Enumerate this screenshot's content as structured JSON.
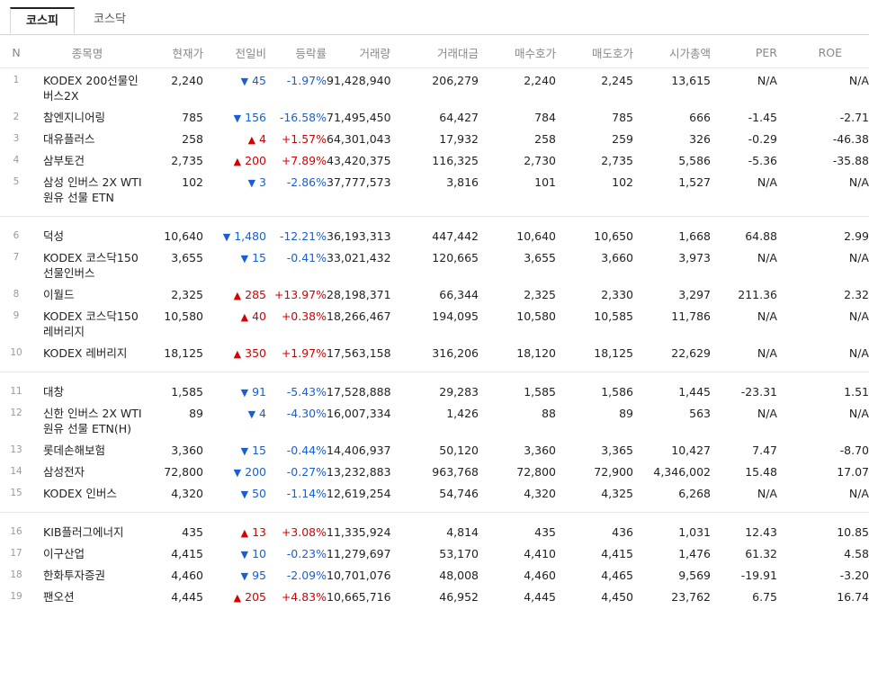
{
  "tabs": [
    {
      "label": "코스피",
      "active": true
    },
    {
      "label": "코스닥",
      "active": false
    }
  ],
  "columns": [
    "N",
    "종목명",
    "현재가",
    "전일비",
    "등락률",
    "거래량",
    "거래대금",
    "매수호가",
    "매도호가",
    "시가총액",
    "PER",
    "ROE"
  ],
  "colors": {
    "up": "#d60000",
    "down": "#1a5fd0"
  },
  "rows": [
    {
      "n": "1",
      "name": "KODEX 200선물인버스2X",
      "price": "2,240",
      "dir": "down",
      "change": "45",
      "rate": "-1.97%",
      "volume": "91,428,940",
      "amount": "206,279",
      "bid": "2,240",
      "ask": "2,245",
      "cap": "13,615",
      "per": "N/A",
      "roe": "N/A"
    },
    {
      "n": "2",
      "name": "참엔지니어링",
      "price": "785",
      "dir": "down",
      "change": "156",
      "rate": "-16.58%",
      "volume": "71,495,450",
      "amount": "64,427",
      "bid": "784",
      "ask": "785",
      "cap": "666",
      "per": "-1.45",
      "roe": "-2.71"
    },
    {
      "n": "3",
      "name": "대유플러스",
      "price": "258",
      "dir": "up",
      "change": "4",
      "rate": "+1.57%",
      "volume": "64,301,043",
      "amount": "17,932",
      "bid": "258",
      "ask": "259",
      "cap": "326",
      "per": "-0.29",
      "roe": "-46.38"
    },
    {
      "n": "4",
      "name": "삼부토건",
      "price": "2,735",
      "dir": "up",
      "change": "200",
      "rate": "+7.89%",
      "volume": "43,420,375",
      "amount": "116,325",
      "bid": "2,730",
      "ask": "2,735",
      "cap": "5,586",
      "per": "-5.36",
      "roe": "-35.88"
    },
    {
      "n": "5",
      "name": "삼성 인버스 2X WTI원유 선물 ETN",
      "price": "102",
      "dir": "down",
      "change": "3",
      "rate": "-2.86%",
      "volume": "37,777,573",
      "amount": "3,816",
      "bid": "101",
      "ask": "102",
      "cap": "1,527",
      "per": "N/A",
      "roe": "N/A"
    },
    {
      "n": "6",
      "name": "덕성",
      "price": "10,640",
      "dir": "down",
      "change": "1,480",
      "rate": "-12.21%",
      "volume": "36,193,313",
      "amount": "447,442",
      "bid": "10,640",
      "ask": "10,650",
      "cap": "1,668",
      "per": "64.88",
      "roe": "2.99"
    },
    {
      "n": "7",
      "name": "KODEX 코스닥150선물인버스",
      "price": "3,655",
      "dir": "down",
      "change": "15",
      "rate": "-0.41%",
      "volume": "33,021,432",
      "amount": "120,665",
      "bid": "3,655",
      "ask": "3,660",
      "cap": "3,973",
      "per": "N/A",
      "roe": "N/A"
    },
    {
      "n": "8",
      "name": "이월드",
      "price": "2,325",
      "dir": "up",
      "change": "285",
      "rate": "+13.97%",
      "volume": "28,198,371",
      "amount": "66,344",
      "bid": "2,325",
      "ask": "2,330",
      "cap": "3,297",
      "per": "211.36",
      "roe": "2.32"
    },
    {
      "n": "9",
      "name": "KODEX 코스닥150레버리지",
      "price": "10,580",
      "dir": "up",
      "change": "40",
      "rate": "+0.38%",
      "volume": "18,266,467",
      "amount": "194,095",
      "bid": "10,580",
      "ask": "10,585",
      "cap": "11,786",
      "per": "N/A",
      "roe": "N/A"
    },
    {
      "n": "10",
      "name": "KODEX 레버리지",
      "price": "18,125",
      "dir": "up",
      "change": "350",
      "rate": "+1.97%",
      "volume": "17,563,158",
      "amount": "316,206",
      "bid": "18,120",
      "ask": "18,125",
      "cap": "22,629",
      "per": "N/A",
      "roe": "N/A"
    },
    {
      "n": "11",
      "name": "대창",
      "price": "1,585",
      "dir": "down",
      "change": "91",
      "rate": "-5.43%",
      "volume": "17,528,888",
      "amount": "29,283",
      "bid": "1,585",
      "ask": "1,586",
      "cap": "1,445",
      "per": "-23.31",
      "roe": "1.51"
    },
    {
      "n": "12",
      "name": "신한 인버스 2X WTI원유 선물 ETN(H)",
      "price": "89",
      "dir": "down",
      "change": "4",
      "rate": "-4.30%",
      "volume": "16,007,334",
      "amount": "1,426",
      "bid": "88",
      "ask": "89",
      "cap": "563",
      "per": "N/A",
      "roe": "N/A"
    },
    {
      "n": "13",
      "name": "롯데손해보험",
      "price": "3,360",
      "dir": "down",
      "change": "15",
      "rate": "-0.44%",
      "volume": "14,406,937",
      "amount": "50,120",
      "bid": "3,360",
      "ask": "3,365",
      "cap": "10,427",
      "per": "7.47",
      "roe": "-8.70"
    },
    {
      "n": "14",
      "name": "삼성전자",
      "price": "72,800",
      "dir": "down",
      "change": "200",
      "rate": "-0.27%",
      "volume": "13,232,883",
      "amount": "963,768",
      "bid": "72,800",
      "ask": "72,900",
      "cap": "4,346,002",
      "per": "15.48",
      "roe": "17.07"
    },
    {
      "n": "15",
      "name": "KODEX 인버스",
      "price": "4,320",
      "dir": "down",
      "change": "50",
      "rate": "-1.14%",
      "volume": "12,619,254",
      "amount": "54,746",
      "bid": "4,320",
      "ask": "4,325",
      "cap": "6,268",
      "per": "N/A",
      "roe": "N/A"
    },
    {
      "n": "16",
      "name": "KIB플러그에너지",
      "price": "435",
      "dir": "up",
      "change": "13",
      "rate": "+3.08%",
      "volume": "11,335,924",
      "amount": "4,814",
      "bid": "435",
      "ask": "436",
      "cap": "1,031",
      "per": "12.43",
      "roe": "10.85"
    },
    {
      "n": "17",
      "name": "이구산업",
      "price": "4,415",
      "dir": "down",
      "change": "10",
      "rate": "-0.23%",
      "volume": "11,279,697",
      "amount": "53,170",
      "bid": "4,410",
      "ask": "4,415",
      "cap": "1,476",
      "per": "61.32",
      "roe": "4.58"
    },
    {
      "n": "18",
      "name": "한화투자증권",
      "price": "4,460",
      "dir": "down",
      "change": "95",
      "rate": "-2.09%",
      "volume": "10,701,076",
      "amount": "48,008",
      "bid": "4,460",
      "ask": "4,465",
      "cap": "9,569",
      "per": "-19.91",
      "roe": "-3.20"
    },
    {
      "n": "19",
      "name": "팬오션",
      "price": "4,445",
      "dir": "up",
      "change": "205",
      "rate": "+4.83%",
      "volume": "10,665,716",
      "amount": "46,952",
      "bid": "4,445",
      "ask": "4,450",
      "cap": "23,762",
      "per": "6.75",
      "roe": "16.74"
    }
  ]
}
